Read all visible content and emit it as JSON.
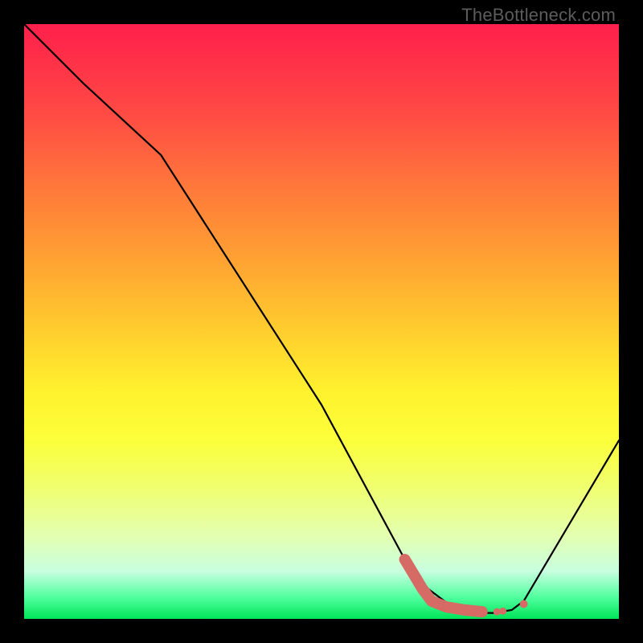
{
  "watermark": "TheBottleneck.com",
  "chart_data": {
    "type": "line",
    "title": "",
    "xlabel": "",
    "ylabel": "",
    "xlim": [
      0,
      100
    ],
    "ylim": [
      0,
      100
    ],
    "series": [
      {
        "name": "bottleneck-curve",
        "color": "#000000",
        "x": [
          0,
          10,
          23,
          50,
          64,
          68,
          72,
          76,
          79,
          82,
          84,
          100
        ],
        "y": [
          100,
          90,
          78,
          36,
          10,
          5,
          2,
          1,
          1,
          1.5,
          3,
          30
        ]
      }
    ],
    "marker_segments": [
      {
        "name": "optimal-range-highlight",
        "color": "#d66a64",
        "points": [
          {
            "x": 64,
            "y": 10
          },
          {
            "x": 67,
            "y": 5
          },
          {
            "x": 68.5,
            "y": 3
          },
          {
            "x": 71,
            "y": 2
          },
          {
            "x": 74,
            "y": 1.5
          },
          {
            "x": 77,
            "y": 1.2
          }
        ]
      }
    ],
    "marker_dots": [
      {
        "x": 79.5,
        "y": 1.2,
        "r": 4.5,
        "color": "#d66a64"
      },
      {
        "x": 80.5,
        "y": 1.3,
        "r": 4.5,
        "color": "#d66a64"
      },
      {
        "x": 84,
        "y": 2.5,
        "r": 5.0,
        "color": "#d66a64"
      }
    ]
  }
}
